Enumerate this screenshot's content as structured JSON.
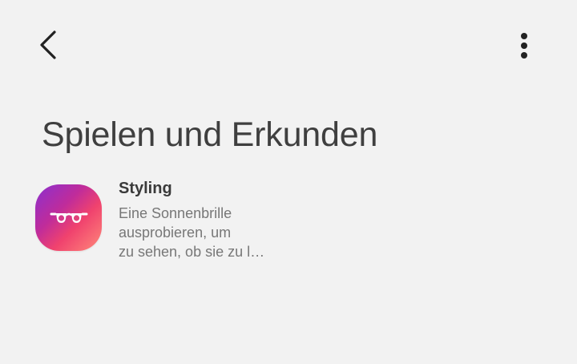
{
  "header": {
    "back_icon": "chevron-left-icon",
    "more_icon": "more-vertical-icon"
  },
  "page": {
    "title": "Spielen und Erkunden"
  },
  "items": [
    {
      "icon": "glasses-icon",
      "title": "Styling",
      "description_lines": [
        "Eine Sonnenbrille",
        "ausprobieren, um",
        "zu sehen, ob sie zu l…"
      ]
    }
  ],
  "colors": {
    "background": "#f2f2f2",
    "title_text": "#3f3f3f",
    "secondary_text": "#777777",
    "icon_gradient_start": "#8a2fd0",
    "icon_gradient_end": "#ff8a7a"
  }
}
